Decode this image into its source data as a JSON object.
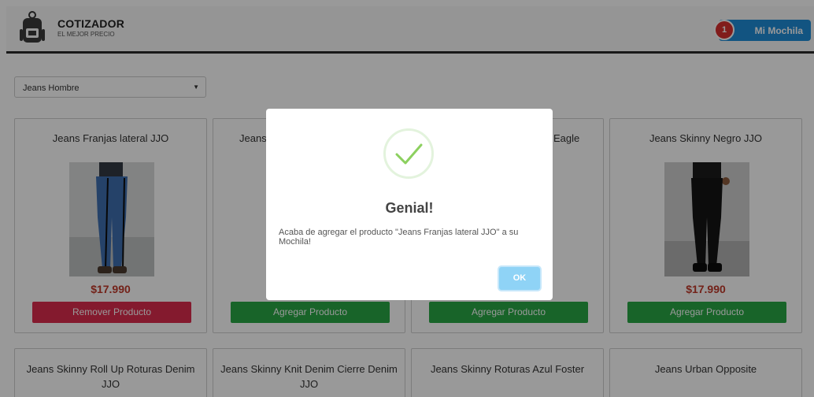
{
  "header": {
    "brand_title": "COTIZADOR",
    "brand_subtitle": "EL MEJOR PRECIO",
    "cart_label": "Mi Mochila",
    "cart_count": "1"
  },
  "filter": {
    "selected": "Jeans Hombre"
  },
  "products": [
    {
      "title": "Jeans Franjas lateral JJO",
      "price": "$17.990",
      "button": "Remover Producto"
    },
    {
      "title": "Jeans",
      "button": "Agregar Producto"
    },
    {
      "title": "Eagle",
      "button": "Agregar Producto"
    },
    {
      "title": "Jeans Skinny Negro JJO",
      "price": "$17.990",
      "button": "Agregar Producto"
    }
  ],
  "products_row2": [
    {
      "title": "Jeans Skinny Roll Up Roturas Denim JJO"
    },
    {
      "title": "Jeans Skinny Knit Denim Cierre Denim JJO"
    },
    {
      "title": "Jeans Skinny Roturas Azul Foster"
    },
    {
      "title": "Jeans Urban Opposite"
    }
  ],
  "modal": {
    "title": "Genial!",
    "message": "Acaba de agregar el producto \"Jeans Franjas lateral JJO\" a su Mochila!",
    "ok_label": "OK"
  },
  "colors": {
    "accent_blue": "#1e8cd8",
    "badge_red": "#d82f2f",
    "remove_red": "#dd2c4e",
    "add_green": "#28a745",
    "price_red": "#c0392b",
    "success_green": "#8cd05f"
  },
  "icons": [
    "backpack-icon",
    "check-icon",
    "dropdown-caret-icon"
  ]
}
